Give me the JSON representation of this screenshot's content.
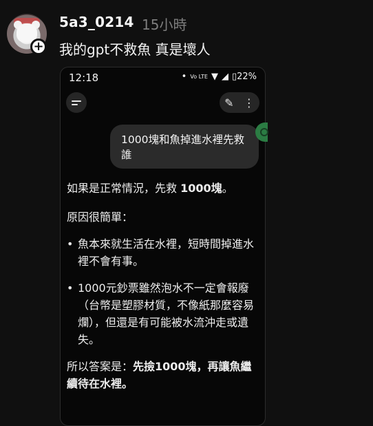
{
  "post": {
    "username": "5a3_0214",
    "time": "15小時",
    "caption": "我的gpt不救魚 真是壞人"
  },
  "phone": {
    "status": {
      "time": "12:18",
      "dot": "•",
      "volte": "Vo\nLTE",
      "wifi": "▼",
      "signal": "◢",
      "battery": "▯22%"
    },
    "chat": {
      "user_message": "1000塊和魚掉進水裡先救誰",
      "answer": {
        "p1_prefix": "如果是正常情況，先救 ",
        "p1_bold": "1000塊",
        "p1_suffix": "。",
        "p2": "原因很簡單：",
        "bullet_1": "魚本來就生活在水裡，短時間掉進水裡不會有事。",
        "bullet_2": "1000元鈔票雖然泡水不一定會報廢（台幣是塑膠材質，不像紙那麼容易爛），但還是有可能被水流沖走或遺失。",
        "conclusion_prefix": "所以答案是：",
        "conclusion_bold": "先撿1000塊，再讓魚繼續待在水裡。"
      }
    }
  },
  "icons": {
    "plus": "+",
    "more": "⋮",
    "edit": "✎"
  },
  "colors": {
    "background": "#101010",
    "phone_bg": "#070707",
    "bubble_bg": "#2b2b2b",
    "muted_text": "#7e7e7e",
    "accent_green": "#2b7c43"
  }
}
